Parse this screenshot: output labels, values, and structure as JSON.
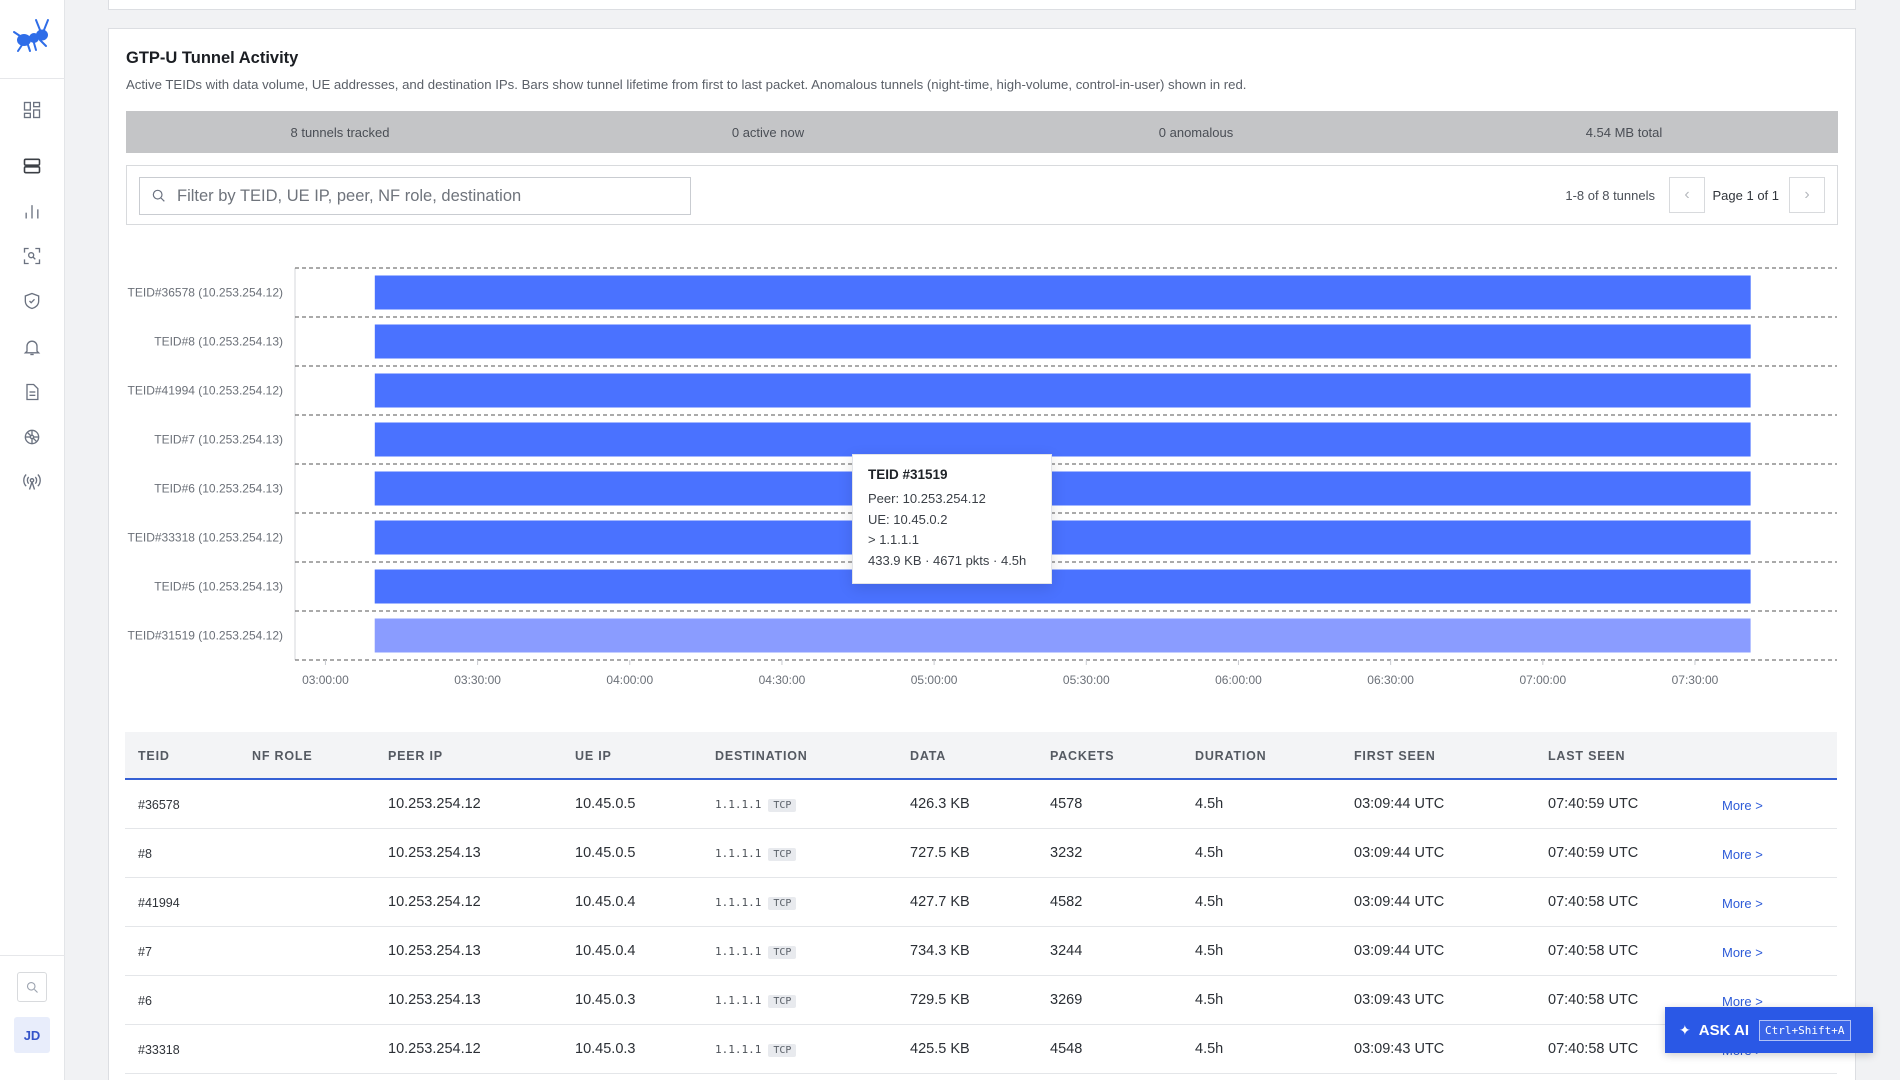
{
  "sidebar": {
    "nav": [
      {
        "name": "dashboard-icon"
      },
      {
        "name": "server-icon"
      },
      {
        "name": "bar-chart-icon"
      },
      {
        "name": "scan-icon"
      },
      {
        "name": "shield-icon"
      },
      {
        "name": "bell-icon"
      },
      {
        "name": "document-icon"
      },
      {
        "name": "network-hub-icon"
      },
      {
        "name": "antenna-icon"
      }
    ],
    "avatar_initials": "JD"
  },
  "panel": {
    "title": "GTP-U Tunnel Activity",
    "description": "Active TEIDs with data volume, UE addresses, and destination IPs. Bars show tunnel lifetime from first to last packet. Anomalous tunnels (night-time, high-volume, control-in-user) shown in red."
  },
  "stats": {
    "tracked": "8 tunnels tracked",
    "active": "0 active now",
    "anomalous": "0 anomalous",
    "total": "4.54 MB total"
  },
  "filter": {
    "placeholder": "Filter by TEID, UE IP, peer, NF role, destination",
    "value": "",
    "range": "1-8 of 8 tunnels",
    "page": "Page 1 of 1",
    "prev": "‹",
    "next": "›"
  },
  "chart_data": {
    "type": "bar",
    "orientation": "horizontal-timeline",
    "categories": [
      "TEID#36578 (10.253.254.12)",
      "TEID#8 (10.253.254.13)",
      "TEID#41994 (10.253.254.12)",
      "TEID#7 (10.253.254.13)",
      "TEID#6 (10.253.254.13)",
      "TEID#33318 (10.253.254.12)",
      "TEID#5 (10.253.254.13)",
      "TEID#31519 (10.253.254.12)"
    ],
    "x_ticks": [
      "03:00:00",
      "03:30:00",
      "04:00:00",
      "04:30:00",
      "05:00:00",
      "05:30:00",
      "06:00:00",
      "06:30:00",
      "07:00:00",
      "07:30:00"
    ],
    "series": [
      {
        "start": [
          "03:09:44",
          "03:09:44",
          "03:09:44",
          "03:09:44",
          "03:09:43",
          "03:09:43",
          "03:09:43",
          "03:09:43"
        ],
        "end": [
          "07:40:59",
          "07:40:59",
          "07:40:58",
          "07:40:58",
          "07:40:58",
          "07:40:58",
          "07:40:58",
          "07:40:58"
        ]
      }
    ],
    "xlim": [
      "02:54:00",
      "07:58:00"
    ],
    "highlighted_index": 7,
    "colors": {
      "bar": "#4a72ff",
      "highlight": "#8a9cff"
    }
  },
  "tooltip": {
    "title": "TEID #31519",
    "peer": "Peer: 10.253.254.12",
    "ue": "UE: 10.45.0.2",
    "dest": "> 1.1.1.1",
    "summary": "433.9 KB · 4671 pkts · 4.5h"
  },
  "table": {
    "headers": [
      "TEID",
      "NF ROLE",
      "PEER IP",
      "UE IP",
      "DESTINATION",
      "DATA",
      "PACKETS",
      "DURATION",
      "FIRST SEEN",
      "LAST SEEN"
    ],
    "rows": [
      {
        "teid": "#36578",
        "role": "",
        "peer": "10.253.254.12",
        "ue": "10.45.0.5",
        "dest": "1.1.1.1",
        "proto": "TCP",
        "data": "426.3 KB",
        "packets": "4578",
        "duration": "4.5h",
        "first": "03:09:44 UTC",
        "last": "07:40:59 UTC",
        "more": "More >"
      },
      {
        "teid": "#8",
        "role": "",
        "peer": "10.253.254.13",
        "ue": "10.45.0.5",
        "dest": "1.1.1.1",
        "proto": "TCP",
        "data": "727.5 KB",
        "packets": "3232",
        "duration": "4.5h",
        "first": "03:09:44 UTC",
        "last": "07:40:59 UTC",
        "more": "More >"
      },
      {
        "teid": "#41994",
        "role": "",
        "peer": "10.253.254.12",
        "ue": "10.45.0.4",
        "dest": "1.1.1.1",
        "proto": "TCP",
        "data": "427.7 KB",
        "packets": "4582",
        "duration": "4.5h",
        "first": "03:09:44 UTC",
        "last": "07:40:58 UTC",
        "more": "More >"
      },
      {
        "teid": "#7",
        "role": "",
        "peer": "10.253.254.13",
        "ue": "10.45.0.4",
        "dest": "1.1.1.1",
        "proto": "TCP",
        "data": "734.3 KB",
        "packets": "3244",
        "duration": "4.5h",
        "first": "03:09:44 UTC",
        "last": "07:40:58 UTC",
        "more": "More >"
      },
      {
        "teid": "#6",
        "role": "",
        "peer": "10.253.254.13",
        "ue": "10.45.0.3",
        "dest": "1.1.1.1",
        "proto": "TCP",
        "data": "729.5 KB",
        "packets": "3269",
        "duration": "4.5h",
        "first": "03:09:43 UTC",
        "last": "07:40:58 UTC",
        "more": "More >"
      },
      {
        "teid": "#33318",
        "role": "",
        "peer": "10.253.254.12",
        "ue": "10.45.0.3",
        "dest": "1.1.1.1",
        "proto": "TCP",
        "data": "425.5 KB",
        "packets": "4548",
        "duration": "4.5h",
        "first": "03:09:43 UTC",
        "last": "07:40:58 UTC",
        "more": "More >"
      }
    ]
  },
  "ask_ai": {
    "label": "ASK AI",
    "shortcut": "Ctrl+Shift+A",
    "icon": "sparkle-icon"
  }
}
